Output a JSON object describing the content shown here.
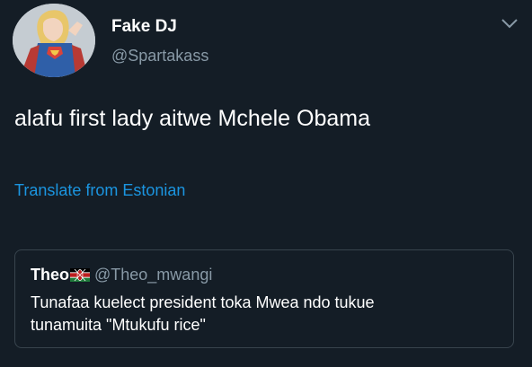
{
  "tweet": {
    "author": {
      "display_name": "Fake DJ",
      "handle": "@Spartakass",
      "avatar_icon": "superhero-avatar"
    },
    "text": "alafu first lady aitwe Mchele Obama",
    "translate_link": "Translate from Estonian",
    "menu_icon": "chevron-down-icon",
    "quoted": {
      "display_name": "Theo",
      "flag_icon": "kenya-flag-icon",
      "handle": "@Theo_mwangi",
      "text_lines": [
        "Tunafaa kuelect president toka Mwea ndo tukue",
        "tunamuita \"Mtukufu rice\""
      ]
    }
  },
  "colors": {
    "background": "#141d26",
    "primary_text": "#ffffff",
    "secondary_text": "#8899a6",
    "link": "#1b95e0",
    "border": "#38444d"
  }
}
